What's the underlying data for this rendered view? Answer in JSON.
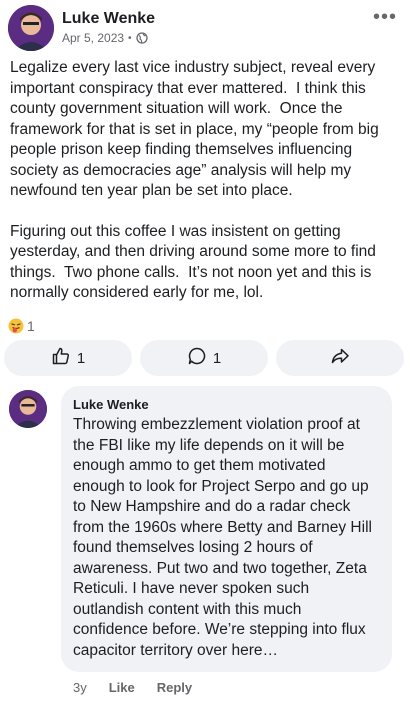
{
  "post": {
    "author": "Luke Wenke",
    "date": "Apr 5, 2023",
    "date_separator": "•",
    "privacy_icon": "globe-icon",
    "more_icon": "more-horizontal-icon",
    "more_label": "•••",
    "paragraphs": [
      "Legalize every last vice industry subject, reveal every important conspiracy that ever mattered.  I think this county government situation will work.  Once the framework for that is set in place, my “people from big people prison keep finding themselves influencing society as democracies age” analysis will help my newfound ten year plan be set into place.",
      "Figuring out this coffee I was insistent on getting yesterday, and then driving around some more to find things.  Two phone calls.  It’s not noon yet and this is normally considered early for me, lol."
    ],
    "reaction_icon": "tongue-face-emoji",
    "reaction_count": "1"
  },
  "actions": {
    "like_icon": "thumbs-up-icon",
    "like_count": "1",
    "comment_icon": "comment-bubble-icon",
    "comment_count": "1",
    "share_icon": "share-arrow-icon"
  },
  "comment": {
    "author": "Luke Wenke",
    "text": "Throwing embezzlement violation proof at the FBI like my life depends on it will be enough ammo to get them motivated enough to look for Project Serpo and go up to New Hampshire and do a radar check from the 1960s where Betty and Barney Hill found themselves losing 2 hours of awareness.  Put two and two together, Zeta Reticuli.  I have never spoken such outlandish content with this much confidence before.  We’re stepping into flux capacitor territory over here…",
    "age": "3y",
    "like_label": "Like",
    "reply_label": "Reply"
  },
  "colors": {
    "text": "#1c1e21",
    "secondary_text": "#65676b",
    "button_bg": "#f0f2f5",
    "avatar_bg": "#4b2a6d"
  }
}
